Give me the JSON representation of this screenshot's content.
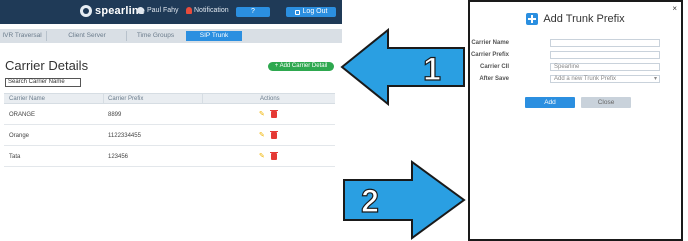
{
  "header": {
    "logo_text": "spearline",
    "user_name": "Paul Fahy",
    "notification_label": "Notification",
    "help_label": "?",
    "logout_label": "Log Out"
  },
  "tabs": [
    {
      "label": "IVR Traversal"
    },
    {
      "label": "Client Server"
    },
    {
      "label": "Time Groups"
    },
    {
      "label": "SIP Trunk",
      "active": true
    }
  ],
  "carrier_page": {
    "title": "Carrier Details",
    "add_button_label": "+ Add Carrier Detail",
    "search_placeholder": "Search Carrier Name",
    "columns": [
      "Carrier Name",
      "Carrier Prefix",
      "Actions"
    ],
    "rows": [
      {
        "name": "ORANGE",
        "prefix": "8899"
      },
      {
        "name": "Orange",
        "prefix": "1122334455"
      },
      {
        "name": "Tata",
        "prefix": "123456"
      }
    ]
  },
  "annotations": {
    "arrow_1_label": "1",
    "arrow_2_label": "2",
    "arrow_color": "#2a9fe2"
  },
  "modal": {
    "title": "Add Trunk Prefix",
    "close_glyph": "×",
    "fields": [
      {
        "label": "Carrier Name",
        "value": ""
      },
      {
        "label": "Carrier Prefix",
        "value": ""
      },
      {
        "label": "Carrier CII",
        "value": "Spearline"
      },
      {
        "label": "After Save",
        "value": "Add a new Trunk Prefix"
      }
    ],
    "add_label": "Add",
    "close_label": "Close"
  },
  "colors": {
    "topbar": "#1f3a57",
    "accent_blue": "#2b8fe0",
    "green": "#2ea84f"
  }
}
